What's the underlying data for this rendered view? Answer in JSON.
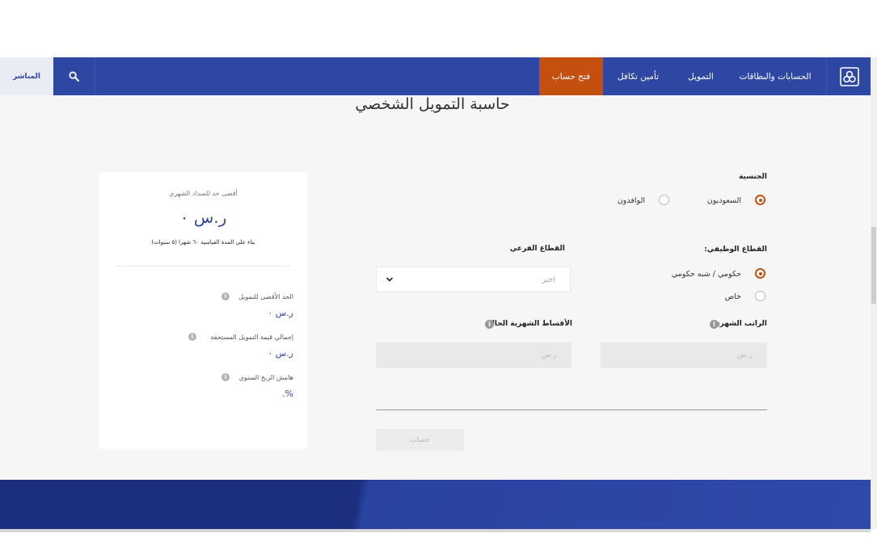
{
  "header": {
    "live_label": "المباشر",
    "nav": {
      "open_account": "فتح حساب",
      "takaful": "تأمين تكافل",
      "finance": "التمويل",
      "accounts_cards": "الحسابات والبطاقات"
    },
    "icons": {
      "search": "search-icon",
      "logo": "bank-logo-icon"
    }
  },
  "page": {
    "title": "حاسبة التمويل الشخصي"
  },
  "form": {
    "nationality": {
      "label": "الجنسية",
      "options": [
        "السعوديون",
        "الوافدون"
      ],
      "selected": "السعوديون"
    },
    "employment_sector": {
      "label": "القطاع الوظيفي:",
      "options": [
        "حكومي / شبه حكومي",
        "خاص"
      ],
      "selected": "حكومي / شبه حكومي"
    },
    "sub_sector": {
      "label": "القطاع الفرعي",
      "placeholder": "اختر"
    },
    "monthly_salary": {
      "label": "الراتب الشهري",
      "placeholder": "ر.س"
    },
    "current_installments": {
      "label": "الأقساط الشهرية الحالية",
      "placeholder": "ر.س"
    },
    "calculate_label": "حساب"
  },
  "results": {
    "max_payment_label": "أقصى حد للسداد الشهري",
    "max_payment_value": "ر.س ٠",
    "tenor_note": "بناء على المدة القياسية ٦٠ شهرا (٥ سنوات)",
    "max_finance_label": "الحد الأقصى للتمويل",
    "max_finance_value": "ر.س ٠",
    "total_due_label": "إجمالي قيمة التمويل المستحقة",
    "total_due_value": "ر.س ٠",
    "annual_profit_label": "هامش الربح السنوي",
    "annual_profit_value": "%."
  },
  "colors": {
    "brand_blue": "#2e47a3",
    "accent_orange": "#c4500f",
    "footer_blue": "#1b2f7e"
  }
}
